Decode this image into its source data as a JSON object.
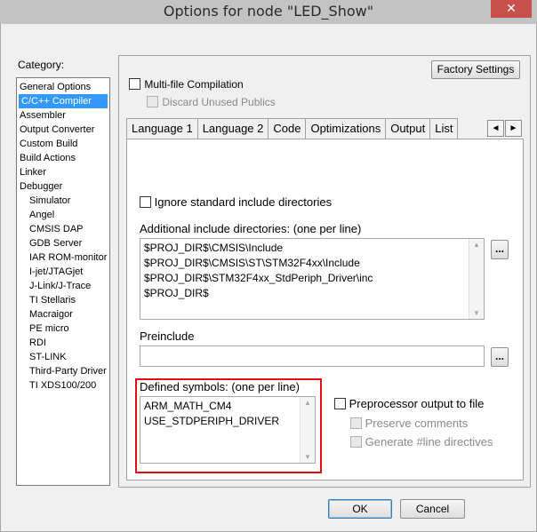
{
  "window": {
    "title": "Options for node \"LED_Show\"",
    "close_glyph": "✕"
  },
  "category": {
    "label": "Category:",
    "items": [
      {
        "label": "General Options",
        "indent": false,
        "selected": false
      },
      {
        "label": "C/C++ Compiler",
        "indent": false,
        "selected": true
      },
      {
        "label": "Assembler",
        "indent": false,
        "selected": false
      },
      {
        "label": "Output Converter",
        "indent": false,
        "selected": false
      },
      {
        "label": "Custom Build",
        "indent": false,
        "selected": false
      },
      {
        "label": "Build Actions",
        "indent": false,
        "selected": false
      },
      {
        "label": "Linker",
        "indent": false,
        "selected": false
      },
      {
        "label": "Debugger",
        "indent": false,
        "selected": false
      },
      {
        "label": "Simulator",
        "indent": true,
        "selected": false
      },
      {
        "label": "Angel",
        "indent": true,
        "selected": false
      },
      {
        "label": "CMSIS DAP",
        "indent": true,
        "selected": false
      },
      {
        "label": "GDB Server",
        "indent": true,
        "selected": false
      },
      {
        "label": "IAR ROM-monitor",
        "indent": true,
        "selected": false
      },
      {
        "label": "I-jet/JTAGjet",
        "indent": true,
        "selected": false
      },
      {
        "label": "J-Link/J-Trace",
        "indent": true,
        "selected": false
      },
      {
        "label": "TI Stellaris",
        "indent": true,
        "selected": false
      },
      {
        "label": "Macraigor",
        "indent": true,
        "selected": false
      },
      {
        "label": "PE micro",
        "indent": true,
        "selected": false
      },
      {
        "label": "RDI",
        "indent": true,
        "selected": false
      },
      {
        "label": "ST-LINK",
        "indent": true,
        "selected": false
      },
      {
        "label": "Third-Party Driver",
        "indent": true,
        "selected": false
      },
      {
        "label": "TI XDS100/200",
        "indent": true,
        "selected": false
      }
    ]
  },
  "panel": {
    "factory_settings": "Factory Settings",
    "multi_file": "Multi-file Compilation",
    "discard_unused": "Discard Unused Publics"
  },
  "tabs": [
    {
      "label": "Language 1",
      "active": false
    },
    {
      "label": "Language 2",
      "active": false
    },
    {
      "label": "Code",
      "active": false
    },
    {
      "label": "Optimizations",
      "active": false
    },
    {
      "label": "Output",
      "active": false
    },
    {
      "label": "List",
      "active": false
    }
  ],
  "tab_scroll": {
    "left": "◄",
    "right": "►"
  },
  "preprocessor": {
    "ignore_std": "Ignore standard include directories",
    "additional_label": "Additional include directories: (one per line)",
    "include_dirs": [
      "$PROJ_DIR$\\CMSIS\\Include",
      "$PROJ_DIR$\\CMSIS\\ST\\STM32F4xx\\Include",
      "$PROJ_DIR$\\STM32F4xx_StdPeriph_Driver\\inc",
      "$PROJ_DIR$"
    ],
    "browse": "...",
    "preinclude_label": "Preinclude",
    "preinclude_value": "",
    "defined_label": "Defined symbols: (one per line)",
    "defined_symbols": [
      "ARM_MATH_CM4",
      "USE_STDPERIPH_DRIVER"
    ],
    "pp_output": "Preprocessor output to file",
    "preserve_comments": "Preserve comments",
    "generate_line": "Generate #line directives"
  },
  "buttons": {
    "ok": "OK",
    "cancel": "Cancel"
  },
  "colors": {
    "highlight": "#e01010",
    "selection": "#3399ff"
  }
}
